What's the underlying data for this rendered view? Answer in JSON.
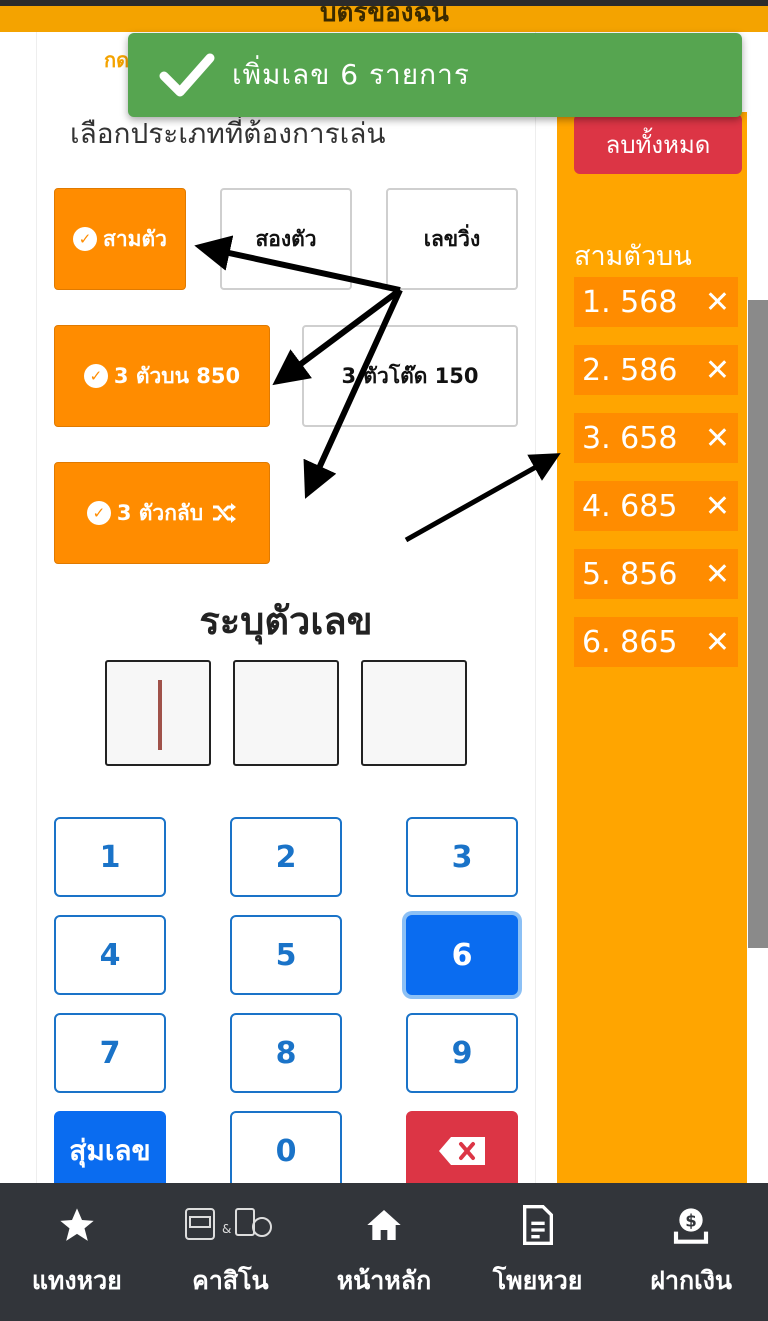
{
  "header": {
    "title": "บัตรของฉัน"
  },
  "tab_partial": "กด",
  "toast": {
    "text": "เพิ่มเลข 6 รายการ"
  },
  "section_title": "เลือกประเภทที่ต้องการเล่น",
  "type_buttons": [
    {
      "label": "สามตัว",
      "selected": true
    },
    {
      "label": "สองตัว",
      "selected": false
    },
    {
      "label": "เลขวิ่ง",
      "selected": false
    }
  ],
  "bet_options": [
    {
      "label": "3 ตัวบน 850",
      "selected": true
    },
    {
      "label": "3 ตัวโต๊ด  150",
      "selected": false
    },
    {
      "label": "3 ตัวกลับ",
      "selected": true,
      "icon": "shuffle-icon"
    }
  ],
  "enter_title": "ระบุตัวเลข",
  "digits": [
    "",
    "",
    ""
  ],
  "keypad": {
    "keys": [
      "1",
      "2",
      "3",
      "4",
      "5",
      "6",
      "7",
      "8",
      "9"
    ],
    "random_label": "สุ่มเลข",
    "zero_label": "0",
    "delete_icon": "backspace-icon",
    "active_key": "6"
  },
  "sidebar": {
    "clear_all_label": "ลบทั้งหมด",
    "list_title": "สามตัวบน",
    "items": [
      {
        "text": "1. 568"
      },
      {
        "text": "2. 586"
      },
      {
        "text": "3. 658"
      },
      {
        "text": "4. 685"
      },
      {
        "text": "5. 856"
      },
      {
        "text": "6. 865"
      }
    ]
  },
  "bottom_nav": [
    {
      "label": "แทงหวย",
      "icon": "star-icon"
    },
    {
      "label": "คาสิโน",
      "icon": "casino-icon"
    },
    {
      "label": "หน้าหลัก",
      "icon": "home-icon"
    },
    {
      "label": "โพยหวย",
      "icon": "document-icon"
    },
    {
      "label": "ฝากเงิน",
      "icon": "deposit-icon"
    }
  ],
  "colors": {
    "primary_orange": "#ff8c00",
    "sidebar_orange": "#ffa500",
    "toast_green": "#56a550",
    "danger_red": "#dc3545",
    "key_blue": "#1a73c8",
    "nav_bg": "#32353a"
  }
}
